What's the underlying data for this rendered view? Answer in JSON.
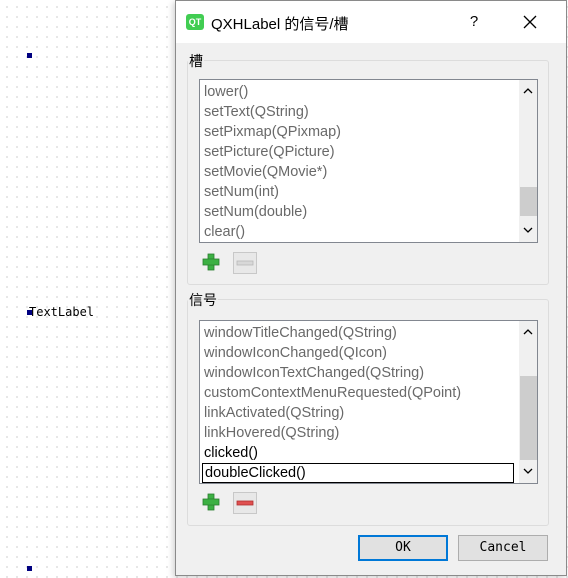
{
  "canvas": {
    "label_text": "TextLabel"
  },
  "dialog": {
    "title": "QXHLabel 的信号/槽",
    "help_label": "?",
    "app_icon": "qt-logo-icon",
    "app_icon_text": "QT",
    "slots_group": {
      "title": "槽",
      "items": [
        "lower()",
        "setText(QString)",
        "setPixmap(QPixmap)",
        "setPicture(QPicture)",
        "setMovie(QMovie*)",
        "setNum(int)",
        "setNum(double)",
        "clear()"
      ]
    },
    "signals_group": {
      "title": "信号",
      "items": [
        "windowTitleChanged(QString)",
        "windowIconChanged(QIcon)",
        "windowIconTextChanged(QString)",
        "customContextMenuRequested(QPoint)",
        "linkActivated(QString)",
        "linkHovered(QString)",
        "clicked()",
        "doubleClicked()"
      ],
      "custom_items": [
        "clicked()",
        "doubleClicked()"
      ],
      "selected_item": "doubleClicked()"
    },
    "buttons": {
      "ok": "OK",
      "cancel": "Cancel"
    },
    "colors": {
      "inherited_text": "#696969",
      "custom_text": "#000000",
      "default_button_border": "#0078d7",
      "add_icon": "#3cb043",
      "remove_icon": "#e05050"
    }
  }
}
